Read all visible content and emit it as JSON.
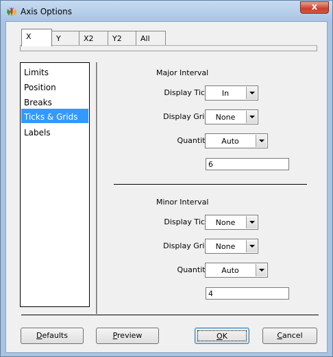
{
  "window": {
    "title": "Axis Options",
    "close_symbol": "x"
  },
  "tabs": [
    {
      "label": "X",
      "active": true
    },
    {
      "label": "Y",
      "active": false
    },
    {
      "label": "X2",
      "active": false
    },
    {
      "label": "Y2",
      "active": false
    },
    {
      "label": "All",
      "active": false
    }
  ],
  "sidebar": {
    "items": [
      {
        "label": "Limits",
        "selected": false
      },
      {
        "label": "Position",
        "selected": false
      },
      {
        "label": "Breaks",
        "selected": false
      },
      {
        "label": "Ticks & Grids",
        "selected": true
      },
      {
        "label": "Labels",
        "selected": false
      }
    ]
  },
  "major": {
    "title": "Major Interval",
    "display_tick_label": "Display Tick:",
    "display_tick_value": "In",
    "display_grid_label": "Display Grid:",
    "display_grid_value": "None",
    "quantity_label": "Quantity:",
    "quantity_value": "Auto",
    "count_value": "6"
  },
  "minor": {
    "title": "Minor Interval",
    "display_tick_label": "Display Tick:",
    "display_tick_value": "None",
    "display_grid_label": "Display Grid:",
    "display_grid_value": "None",
    "quantity_label": "Quantity:",
    "quantity_value": "Auto",
    "count_value": "4"
  },
  "buttons": {
    "defaults": {
      "pre": "",
      "key": "D",
      "post": "efaults"
    },
    "preview": {
      "pre": "",
      "key": "P",
      "post": "review"
    },
    "ok": {
      "pre": "",
      "key": "O",
      "post": "K"
    },
    "cancel": {
      "pre": "",
      "key": "C",
      "post": "ancel"
    }
  },
  "colors": {
    "selection": "#3399ff",
    "title_bar": "#a9c4e3",
    "close_button": "#c9412b"
  }
}
